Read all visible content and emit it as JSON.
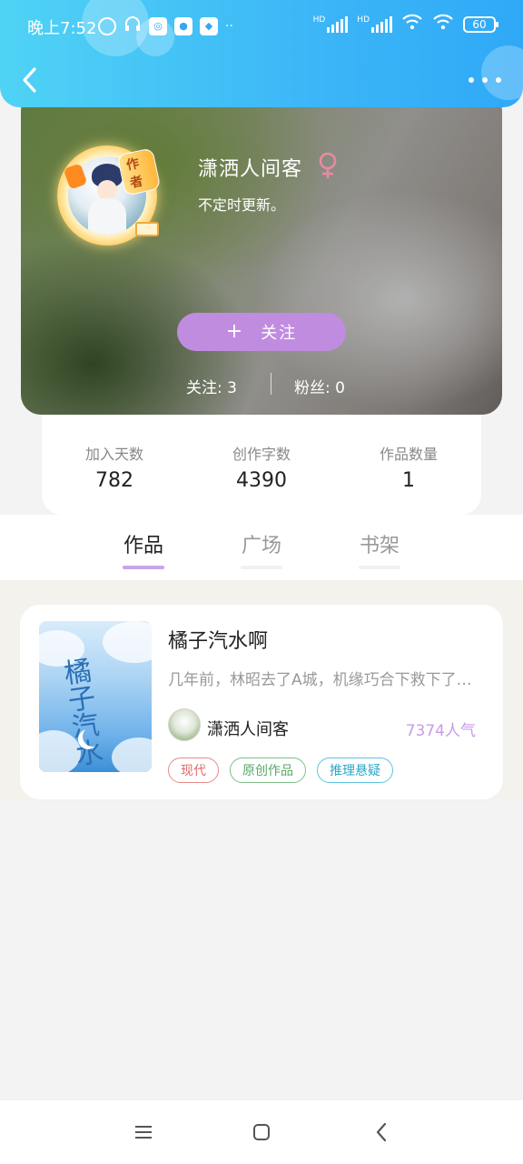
{
  "status_bar": {
    "time": "晚上7:52",
    "network_left": "HD",
    "network_right": "HD",
    "battery": "60"
  },
  "header": {
    "back_icon": "chevron-left-icon",
    "more_icon": "more-dots-icon"
  },
  "profile": {
    "name": "潇洒人间客",
    "badge": "作者",
    "gender_icon": "female-icon",
    "bio": "不定时更新。",
    "follow_button": "关注",
    "follow_plus": "+",
    "following_text": "关注: 3",
    "fans_text": "粉丝: 0"
  },
  "stats": [
    {
      "label": "加入天数",
      "value": "782"
    },
    {
      "label": "创作字数",
      "value": "4390"
    },
    {
      "label": "作品数量",
      "value": "1"
    }
  ],
  "tabs": [
    {
      "label": "作品",
      "active": true
    },
    {
      "label": "广场",
      "active": false
    },
    {
      "label": "书架",
      "active": false
    }
  ],
  "book": {
    "title": "橘子汽水啊",
    "cover_title": "橘子汽水",
    "description": "几年前，林昭去了A城，机缘巧合下救下了一个少年",
    "author": "潇洒人间客",
    "popularity": "7374人气",
    "tags": [
      "现代",
      "原创作品",
      "推理悬疑"
    ]
  },
  "colors": {
    "header_gradient_start": "#4fd3f5",
    "header_gradient_end": "#2fa9f7",
    "follow_button": "#c08ce0",
    "tab_indicator": "#c7a6e6",
    "popularity": "#c89bea",
    "tag_colors": [
      "#e06a6a",
      "#58a865",
      "#2aa6c9"
    ]
  },
  "nav": {
    "menu_icon": "menu-icon",
    "home_icon": "home-square-icon",
    "back_icon": "back-triangle-icon"
  }
}
